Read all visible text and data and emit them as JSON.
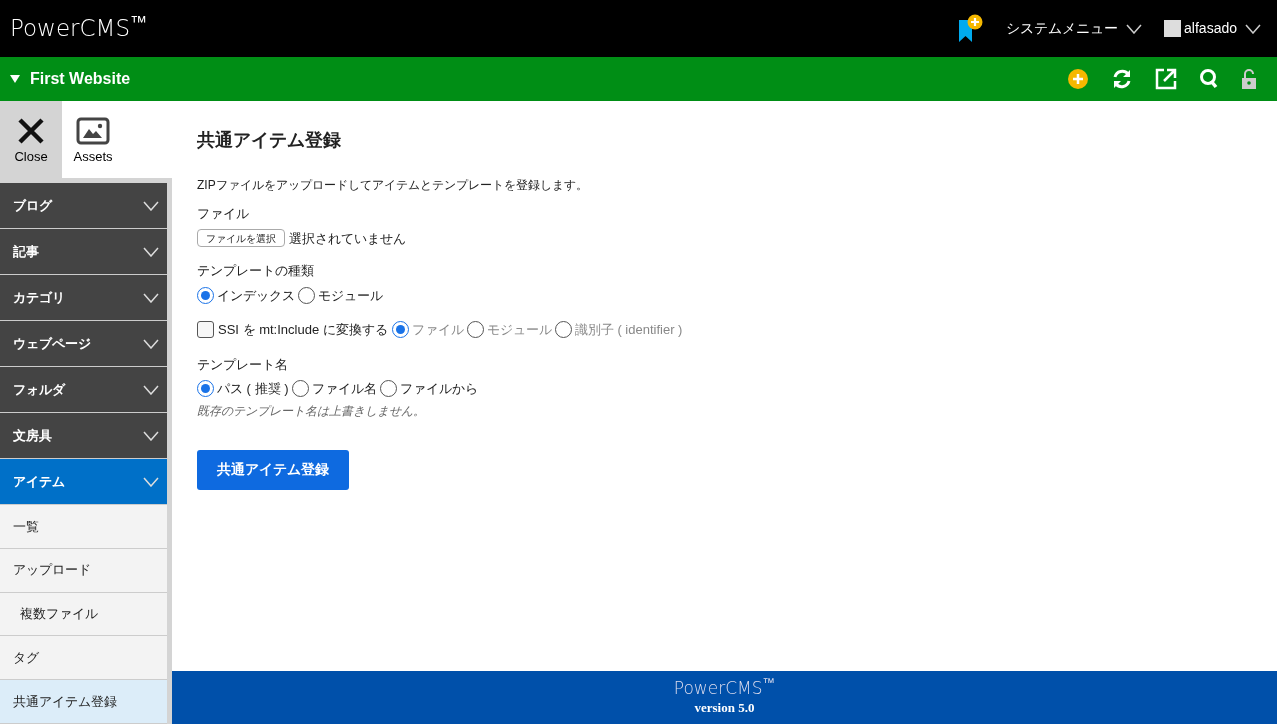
{
  "header": {
    "logo": "PowerCMS$^{™}$",
    "system_menu": "システムメニュー",
    "user": "alfasado"
  },
  "site_bar": {
    "title": "First Website",
    "expanded": true
  },
  "side_tabs": [
    {
      "label": "Close",
      "kind": "close",
      "selected": true
    },
    {
      "label": "Assets",
      "kind": "assets",
      "selected": false
    }
  ],
  "sidebar": {
    "items": [
      {
        "label": "ブログ",
        "selected": false
      },
      {
        "label": "記事",
        "selected": false
      },
      {
        "label": "カテゴリ",
        "selected": false
      },
      {
        "label": "ウェブページ",
        "selected": false
      },
      {
        "label": "フォルダ",
        "selected": false
      },
      {
        "label": "文房具",
        "selected": false
      },
      {
        "label": "アイテム",
        "selected": true,
        "children": [
          {
            "label": "一覧",
            "selected": false
          },
          {
            "label": "アップロード",
            "selected": false,
            "children": [
              {
                "label": "複数ファイル",
                "selected": false
              }
            ]
          },
          {
            "label": "タグ",
            "selected": false
          },
          {
            "label": "共通アイテム登録",
            "selected": true
          }
        ]
      }
    ]
  },
  "page": {
    "title": "共通アイテム登録",
    "description": "ZIPファイルをアップロードしてアイテムとテンプレートを登録します。",
    "file": {
      "label": "ファイル",
      "button": "ファイルを選択",
      "status": "選択されていません"
    },
    "template_type": {
      "label": "テンプレートの種類",
      "options": [
        {
          "label": "インデックス",
          "selected": true
        },
        {
          "label": "モジュール",
          "selected": false
        }
      ]
    },
    "ssi": {
      "label": "SSI を mt:Include に変換する",
      "checked": false,
      "options": [
        {
          "label": "ファイル",
          "selected": true
        },
        {
          "label": "モジュール",
          "selected": false
        },
        {
          "label": "識別子 ( identifier )",
          "selected": false
        }
      ]
    },
    "template_name": {
      "label": "テンプレート名",
      "options": [
        {
          "label": "パス ( 推奨 )",
          "selected": true
        },
        {
          "label": "ファイル名",
          "selected": false
        },
        {
          "label": "ファイルから",
          "selected": false
        }
      ],
      "note": "既存のテンプレート名は上書きしません。"
    },
    "submit": "共通アイテム登録"
  },
  "footer": {
    "logo": "PowerCMS$^{™}$",
    "version": "version 5.0"
  }
}
